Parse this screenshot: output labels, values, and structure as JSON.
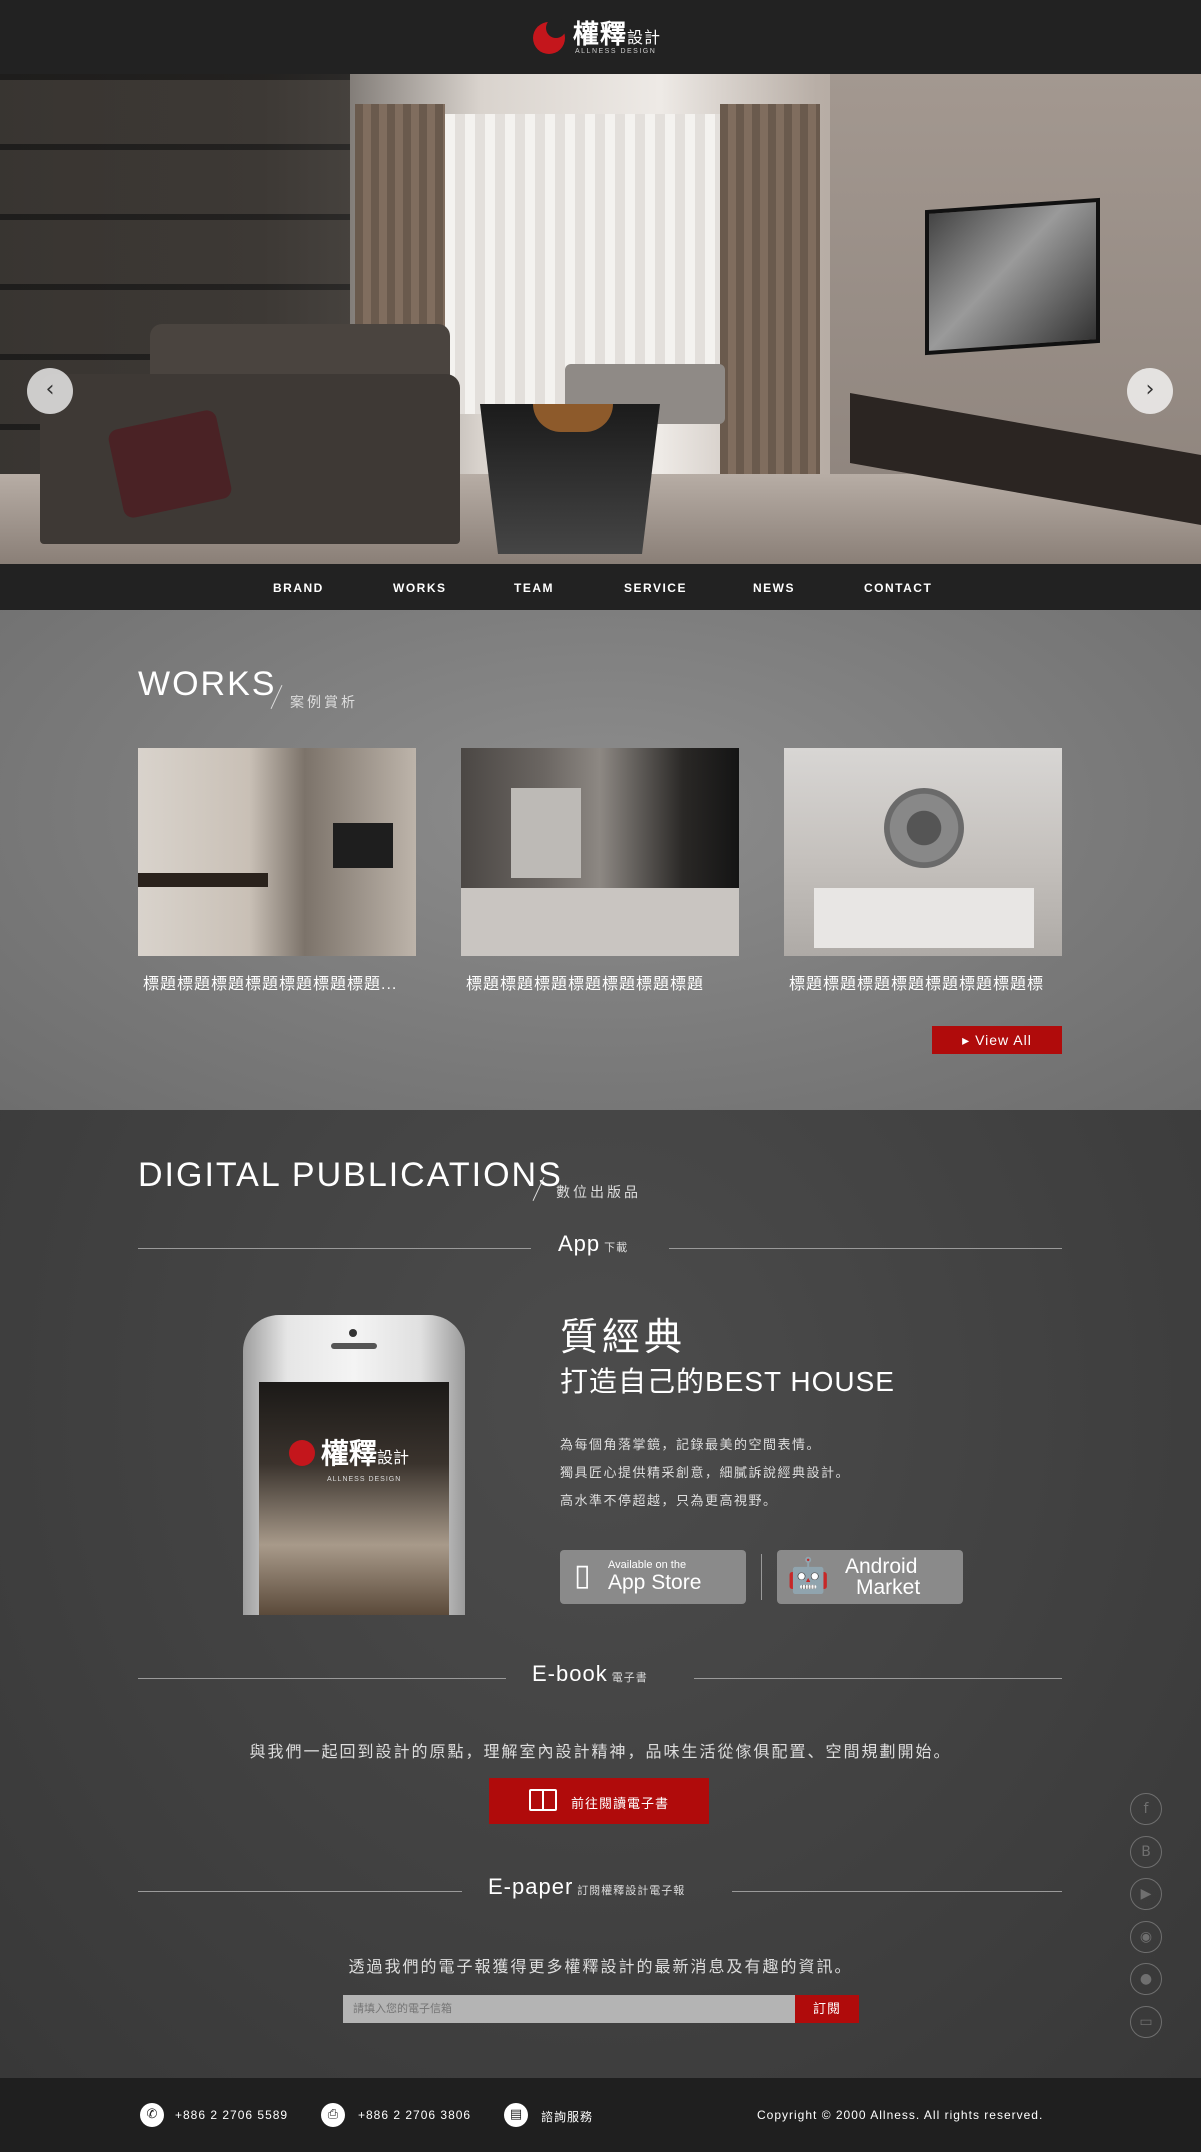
{
  "header": {
    "logo_cn": "權釋",
    "logo_cn_small": "設計",
    "logo_en": "ALLNESS DESIGN"
  },
  "hero": {
    "prev_icon": "chevron-left-icon",
    "next_icon": "chevron-right-icon"
  },
  "nav": {
    "items": [
      "BRAND",
      "WORKS",
      "TEAM",
      "SERVICE",
      "NEWS",
      "CONTACT"
    ]
  },
  "works": {
    "title": "WORKS",
    "subtitle": "案例賞析",
    "cards": [
      {
        "caption": "標題標題標題標題標題標題標題..."
      },
      {
        "caption": "標題標題標題標題標題標題標題"
      },
      {
        "caption": "標題標題標題標題標題標題標題標"
      }
    ],
    "view_all": "View All"
  },
  "publications": {
    "title": "DIGITAL PUBLICATIONS",
    "subtitle": "數位出版品",
    "app": {
      "label": "App",
      "label_small": "下載",
      "heading1": "質經典",
      "heading2": "打造自己的BEST HOUSE",
      "lines": [
        "為每個角落掌鏡，記錄最美的空間表情。",
        "獨具匠心提供精采創意，細膩訴說經典設計。",
        "高水準不停超越，只為更高視野。"
      ],
      "appstore_small": "Available on the",
      "appstore_big": "App Store",
      "android_line1": "Android",
      "android_line2": "Market",
      "phone_logo_cn": "權釋",
      "phone_logo_cn_small": "設計",
      "phone_logo_en": "ALLNESS DESIGN"
    },
    "ebook": {
      "label": "E-book",
      "label_small": "電子書",
      "text": "與我們一起回到設計的原點，理解室內設計精神，品味生活從傢俱配置、空間規劃開始。",
      "button": "前往閱讀電子書"
    },
    "epaper": {
      "label": "E-paper",
      "label_small": "訂閱權釋設計電子報",
      "text": "透過我們的電子報獲得更多權釋設計的最新消息及有趣的資訊。",
      "placeholder": "請填入您的電子信箱",
      "button": "訂閱"
    }
  },
  "social": [
    "facebook-icon",
    "blogger-icon",
    "youtube-icon",
    "android-icon",
    "apple-icon",
    "book-icon"
  ],
  "footer": {
    "phone": "+886 2 2706 5589",
    "fax": "+886 2 2706 3806",
    "service": "諮詢服務",
    "copyright": "Copyright © 2000 Allness. All rights reserved."
  },
  "colors": {
    "accent": "#b00b0b",
    "header_bg": "#222222",
    "works_bg": "#7d7d7d",
    "publications_bg": "#424242"
  }
}
